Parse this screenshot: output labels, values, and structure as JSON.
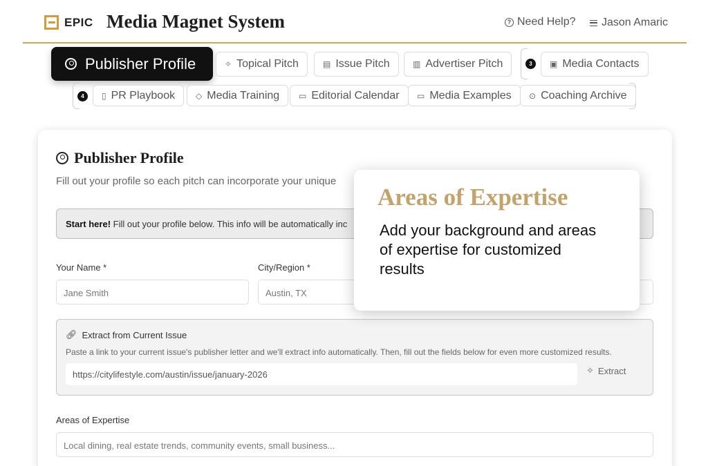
{
  "header": {
    "logo_text": "EPIC",
    "app_title": "Media Magnet System",
    "help_label": "Need Help?",
    "user_name": "Jason Amaric"
  },
  "nav": {
    "active_tab": "Publisher Profile",
    "row1": [
      "Topical Pitch",
      "Issue Pitch",
      "Advertiser Pitch",
      "Media Contacts"
    ],
    "row2": [
      "PR Playbook",
      "Media Training",
      "Editorial Calendar",
      "Media Examples",
      "Coaching Archive"
    ],
    "badge_row1": "3",
    "badge_row2": "4"
  },
  "card": {
    "title": "Publisher Profile",
    "subtitle": "Fill out your profile so each pitch can incorporate your unique",
    "notice_bold": "Start here!",
    "notice_text": " Fill out your profile below. This info will be automatically inc",
    "fields": {
      "name_label": "Your Name *",
      "name_placeholder": "Jane Smith",
      "city_label": "City/Region *",
      "city_placeholder": "Austin, TX"
    },
    "extract": {
      "title": "Extract from Current Issue",
      "description": "Paste a link to your current issue's publisher letter and we'll extract info automatically. Then, fill out the fields below for even more customized results.",
      "url": "https://citylifestyle.com/austin/issue/january-2026",
      "button": "Extract"
    },
    "expertise": {
      "label": "Areas of Expertise",
      "placeholder": "Local dining, real estate trends, community events, small business..."
    }
  },
  "tooltip": {
    "title": "Areas of Expertise",
    "body": "Add your background and areas of expertise for customized results"
  },
  "colors": {
    "accent_gold": "#d6a64f",
    "tooltip_title": "#c4a36b",
    "active_tab_bg": "#111111"
  }
}
